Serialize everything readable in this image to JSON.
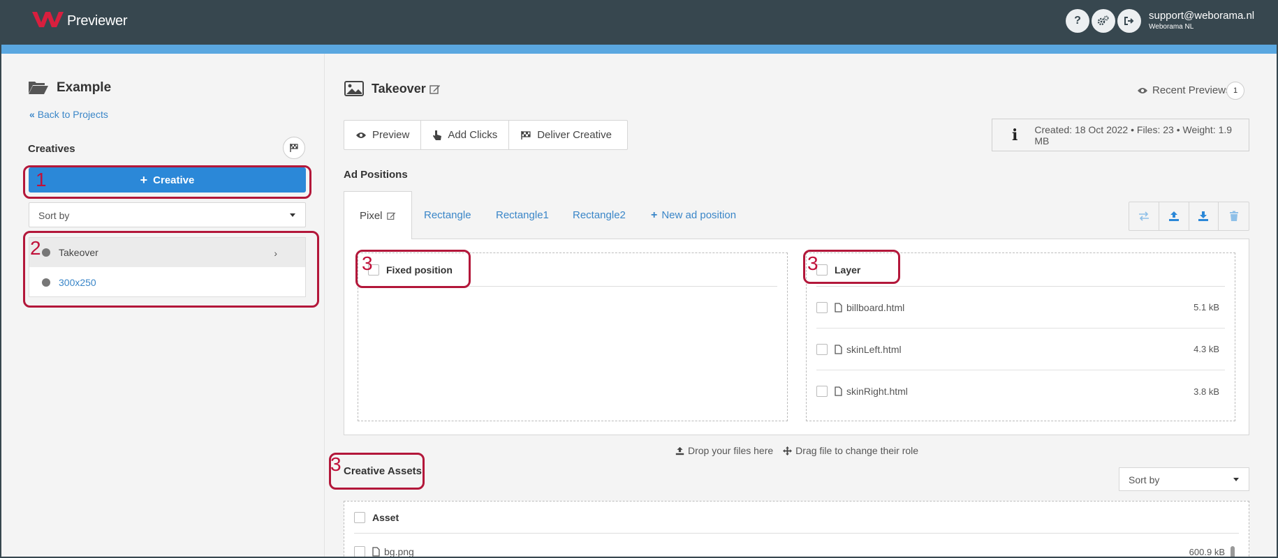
{
  "header": {
    "app_name": "Previewer",
    "user_email": "support@weborama.nl",
    "user_org": "Weborama NL",
    "help_label": "?",
    "brand_color": "#d81f3e"
  },
  "sidebar": {
    "project_name": "Example",
    "back_link": "Back to Projects",
    "creatives_label": "Creatives",
    "add_creative_label": "Creative",
    "sort_placeholder": "Sort by",
    "creatives": [
      {
        "name": "Takeover",
        "active": true
      },
      {
        "name": "300x250",
        "active": false
      }
    ]
  },
  "main": {
    "creative_title": "Takeover",
    "recent_previews_label": "Recent Previews",
    "recent_previews_count": "1",
    "toolbar": {
      "preview": "Preview",
      "add_clicks": "Add Clicks",
      "deliver": "Deliver Creative"
    },
    "info": "Created: 18 Oct 2022 • Files: 23 • Weight: 1.9 MB",
    "ad_positions_label": "Ad Positions",
    "tabs": [
      "Pixel",
      "Rectangle",
      "Rectangle1",
      "Rectangle2",
      "New ad position"
    ],
    "fixed_position_label": "Fixed position",
    "layer_label": "Layer",
    "layer_files": [
      {
        "name": "billboard.html",
        "size": "5.1 kB"
      },
      {
        "name": "skinLeft.html",
        "size": "4.3 kB"
      },
      {
        "name": "skinRight.html",
        "size": "3.8 kB"
      }
    ],
    "drop_hint": "Drop your files here",
    "drag_hint": "Drag file to change their role",
    "creative_assets_label": "Creative Assets",
    "assets_sort": "Sort by",
    "asset_header": "Asset",
    "assets": [
      {
        "name": "bg.png",
        "size": "600.9 kB"
      }
    ]
  },
  "annotations": [
    "1",
    "2",
    "3",
    "3",
    "3"
  ],
  "colors": {
    "topbar": "#37474f",
    "stripe": "#5aa7e0",
    "primary": "#2b88d8",
    "link": "#3a86c8",
    "annotation": "#b3173a"
  }
}
